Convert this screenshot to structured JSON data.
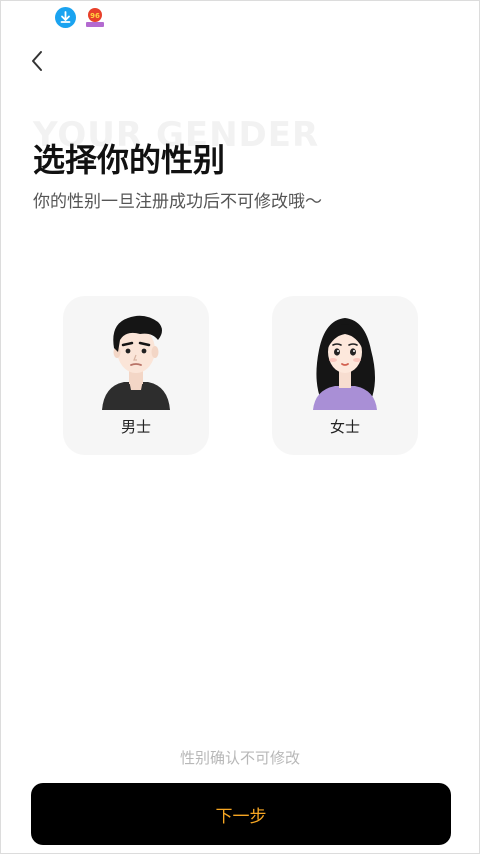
{
  "status_bar": {
    "icons": [
      "download-icon",
      "app-notification-icon"
    ],
    "app_icon_text": "96"
  },
  "nav": {
    "back_icon": "chevron-left-icon"
  },
  "header": {
    "watermark": "YOUR GENDER",
    "title": "选择你的性别",
    "subtitle": "你的性别一旦注册成功后不可修改哦～"
  },
  "genders": [
    {
      "label": "男士",
      "icon": "male-avatar-icon"
    },
    {
      "label": "女士",
      "icon": "female-avatar-icon"
    }
  ],
  "footer": {
    "notice": "性别确认不可修改",
    "next_label": "下一步"
  },
  "colors": {
    "accent": "#f6a623",
    "button_bg": "#000000",
    "card_bg": "#f6f6f6",
    "download_icon": "#1aa3f0",
    "female_shirt": "#a98fd6"
  }
}
